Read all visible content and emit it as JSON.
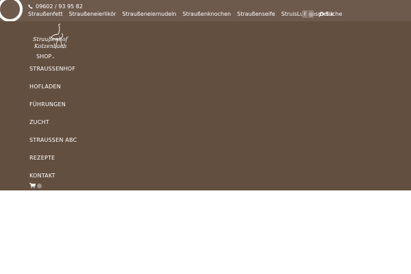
{
  "topbar": {
    "phone": "09602 / 93 95 82",
    "nav_items": [
      "Straußenfett",
      "Straußeneierlikör",
      "Straußeneiernudeln",
      "Straußenknochen",
      "Straußenseife",
      "StruisLux Kosmetik"
    ],
    "social": {
      "facebook": "f",
      "instagram": "◎"
    },
    "search_label": "Suche"
  },
  "logo": {
    "text_line1": "Straußenhof",
    "text_line2": "Kotzenbach"
  },
  "mainnav": {
    "shop_label": "SHOP",
    "items": [
      "STRAUSSENHOF",
      "HOFLADEN",
      "FÜHRUNGEN",
      "ZUCHT",
      "STRAUSSEN ABC",
      "REZEPTE",
      "KONTAKT"
    ]
  },
  "colors": {
    "topbar": "#6e5a4d",
    "mainnav": "#634f40",
    "text": "#ffffff"
  }
}
